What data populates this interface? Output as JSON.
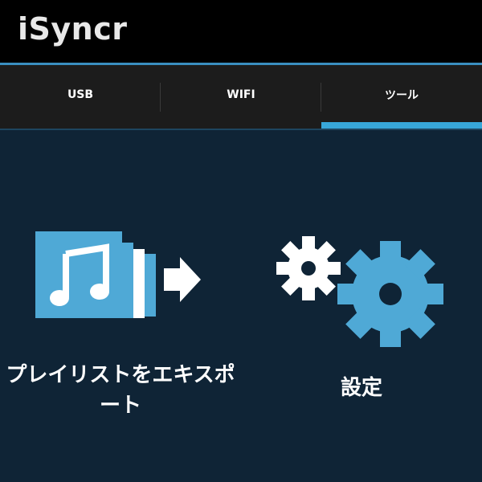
{
  "app": {
    "title": "iSyncr"
  },
  "tabs": [
    {
      "label": "USB",
      "active": false
    },
    {
      "label": "WIFI",
      "active": false
    },
    {
      "label": "ツール",
      "active": true
    }
  ],
  "tools": {
    "export_playlist": {
      "label": "プレイリストをエキスポート",
      "icon": "playlist-export-icon"
    },
    "settings": {
      "label": "設定",
      "icon": "gears-icon"
    }
  },
  "colors": {
    "titlebar_bg": "#000000",
    "accent": "#38a7d9",
    "tabbar_bg": "#1c1c1c",
    "content_bg": "#0f2436",
    "icon_blue": "#4fa9d6"
  }
}
